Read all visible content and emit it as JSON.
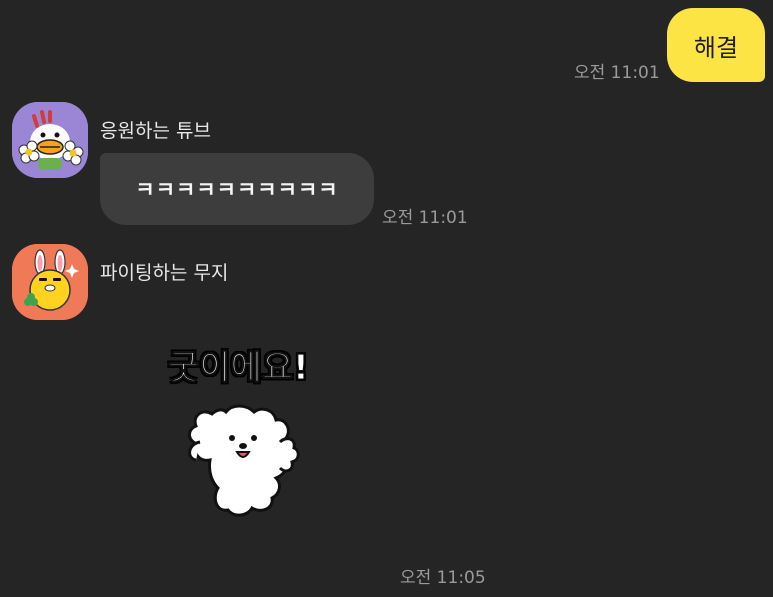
{
  "messages": {
    "sent": {
      "text": "해결",
      "time": "오전 11:01"
    },
    "tube": {
      "sender": "응원하는 튜브",
      "text": "ㅋㅋㅋㅋㅋㅋㅋㅋㅋㅋ",
      "time": "오전 11:01"
    },
    "muzi": {
      "sender": "파이팅하는 무지",
      "sticker_text": "굿이에요!",
      "time": "오전 11:05"
    }
  },
  "colors": {
    "background": "#252525",
    "my_bubble": "#fbe443",
    "other_bubble": "#3d3d3d",
    "tube_avatar_bg": "#9b86d6",
    "muzi_avatar_bg": "#f07a58"
  },
  "icons": {
    "tube_avatar": "tube-cheering-avatar-icon",
    "muzi_avatar": "muzi-fighting-avatar-icon",
    "sticker": "white-puppy-thumbs-up-icon"
  }
}
